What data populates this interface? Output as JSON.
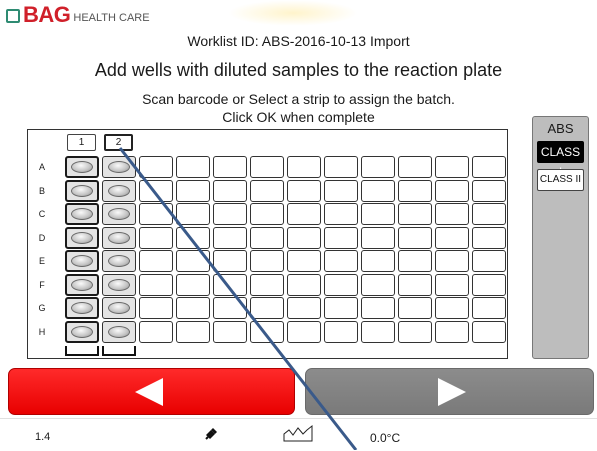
{
  "logo": {
    "brand": "BAG",
    "tagline": "HEALTH CARE"
  },
  "header": {
    "worklist": "Worklist ID: ABS-2016-10-13 Import",
    "heading": "Add wells with diluted samples to the reaction plate",
    "instruction_1": "Scan barcode or Select a strip to assign the batch.",
    "instruction_2": "Click OK when complete"
  },
  "plate": {
    "rows": [
      "A",
      "B",
      "C",
      "D",
      "E",
      "F",
      "G",
      "H"
    ],
    "column_headers": [
      "1",
      "2"
    ],
    "columns_total": 12,
    "filled_columns": 2,
    "selected_column": 1
  },
  "side_panel": {
    "title": "ABS",
    "options": [
      "CLASS I",
      "CLASS II"
    ],
    "selected": "CLASS I"
  },
  "navigation": {
    "back_icon": "left-triangle-icon",
    "next_icon": "right-triangle-icon"
  },
  "status": {
    "version": "1.4",
    "temperature": "0.0°C",
    "icons": [
      "plug-icon",
      "graph-icon"
    ]
  },
  "colors": {
    "back": "#ff0000",
    "next": "#808080",
    "brand_red": "#d0202a",
    "brand_green": "#2e8b72",
    "panel": "#bdbdbd"
  }
}
